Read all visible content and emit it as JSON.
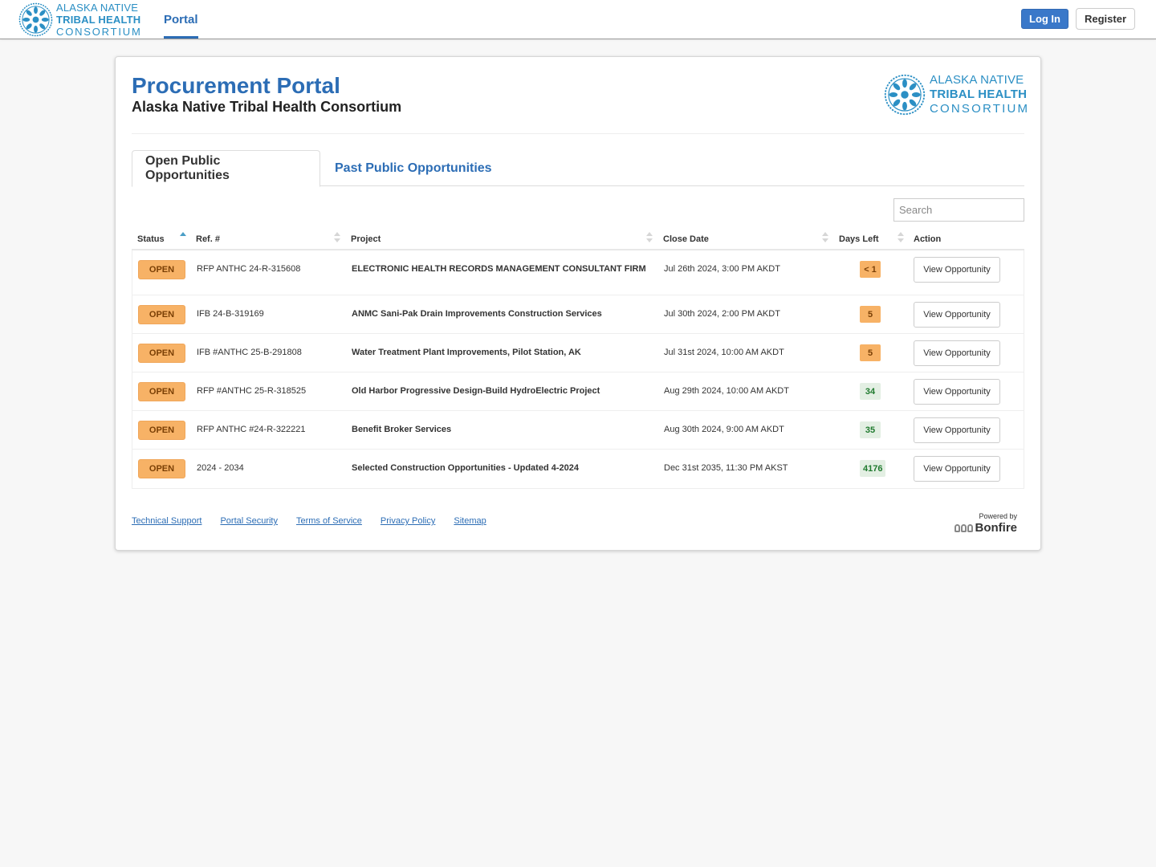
{
  "brand": {
    "logo_line1": "ALASKA NATIVE",
    "logo_line2": "TRIBAL HEALTH",
    "logo_line3": "CONSORTIUM",
    "accent_color": "#2c6db5",
    "logo_color": "#2b8fc4"
  },
  "navbar": {
    "portal_link": "Portal",
    "login_label": "Log In",
    "register_label": "Register"
  },
  "header": {
    "title": "Procurement Portal",
    "subtitle": "Alaska Native Tribal Health Consortium"
  },
  "tabs": [
    {
      "label": "Open Public Opportunities",
      "active": true
    },
    {
      "label": "Past Public Opportunities",
      "active": false
    }
  ],
  "search": {
    "placeholder": "Search",
    "value": ""
  },
  "table": {
    "columns": [
      "Status",
      "Ref. #",
      "Project",
      "Close Date",
      "Days Left",
      "Action"
    ],
    "sorted_column": "Status",
    "sort_direction": "ascending",
    "rows": [
      {
        "status": "OPEN",
        "ref": "RFP ANTHC 24-R-315608",
        "project": "ELECTRONIC HEALTH RECORDS MANAGEMENT CONSULTANT FIRM",
        "close_date": "Jul 26th 2024, 3:00 PM AKDT",
        "days_left": "< 1",
        "days_level": "warn",
        "action": "View Opportunity"
      },
      {
        "status": "OPEN",
        "ref": "IFB 24-B-319169",
        "project": "ANMC Sani-Pak Drain Improvements Construction Services",
        "close_date": "Jul 30th 2024, 2:00 PM AKDT",
        "days_left": "5",
        "days_level": "warn",
        "action": "View Opportunity"
      },
      {
        "status": "OPEN",
        "ref": "IFB #ANTHC 25-B-291808",
        "project": "Water Treatment Plant Improvements, Pilot Station, AK",
        "close_date": "Jul 31st 2024, 10:00 AM AKDT",
        "days_left": "5",
        "days_level": "warn",
        "action": "View Opportunity"
      },
      {
        "status": "OPEN",
        "ref": "RFP #ANTHC 25-R-318525",
        "project": "Old Harbor Progressive Design-Build HydroElectric Project",
        "close_date": "Aug 29th 2024, 10:00 AM AKDT",
        "days_left": "34",
        "days_level": "ok",
        "action": "View Opportunity"
      },
      {
        "status": "OPEN",
        "ref": "RFP ANTHC #24-R-322221",
        "project": "Benefit Broker Services",
        "close_date": "Aug 30th 2024, 9:00 AM AKDT",
        "days_left": "35",
        "days_level": "ok",
        "action": "View Opportunity"
      },
      {
        "status": "OPEN",
        "ref": "2024 - 2034",
        "project": "Selected Construction Opportunities - Updated 4-2024",
        "close_date": "Dec 31st 2035, 11:30 PM AKST",
        "days_left": "4176",
        "days_level": "ok",
        "action": "View Opportunity"
      }
    ]
  },
  "footer": {
    "links": [
      "Technical Support",
      "Portal Security",
      "Terms of Service",
      "Privacy Policy",
      "Sitemap"
    ],
    "powered_by": "Powered by",
    "powered_brand": "Bonfire"
  }
}
